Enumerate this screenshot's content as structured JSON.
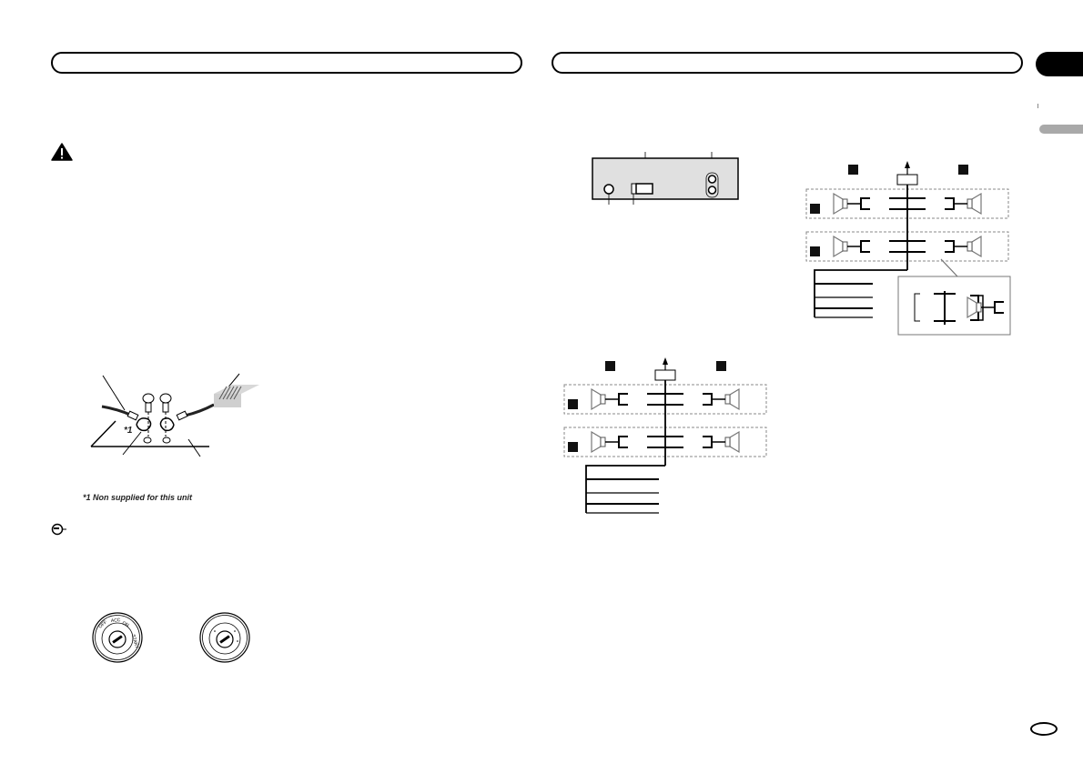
{
  "document": {
    "left_page": {
      "header_title": "",
      "warning_icon": "warning-triangle-icon",
      "ground_diagram": {
        "footnote_marker": "*1",
        "footnote": "*1 Non supplied for this unit"
      },
      "important_icon": "important-hand-icon",
      "ignition_switches": {
        "with_acc_labels": [
          "OFF",
          "ACC",
          "ON",
          "START"
        ],
        "without_acc_labels": []
      }
    },
    "right_page": {
      "header_title": "",
      "section_tab": "",
      "language_tab": "",
      "page_number": ""
    }
  },
  "colors": {
    "ink": "#000000",
    "tab_gray": "#a9a9a9",
    "dashed_box": "#888888",
    "panel_fill": "#e0e0e0"
  }
}
